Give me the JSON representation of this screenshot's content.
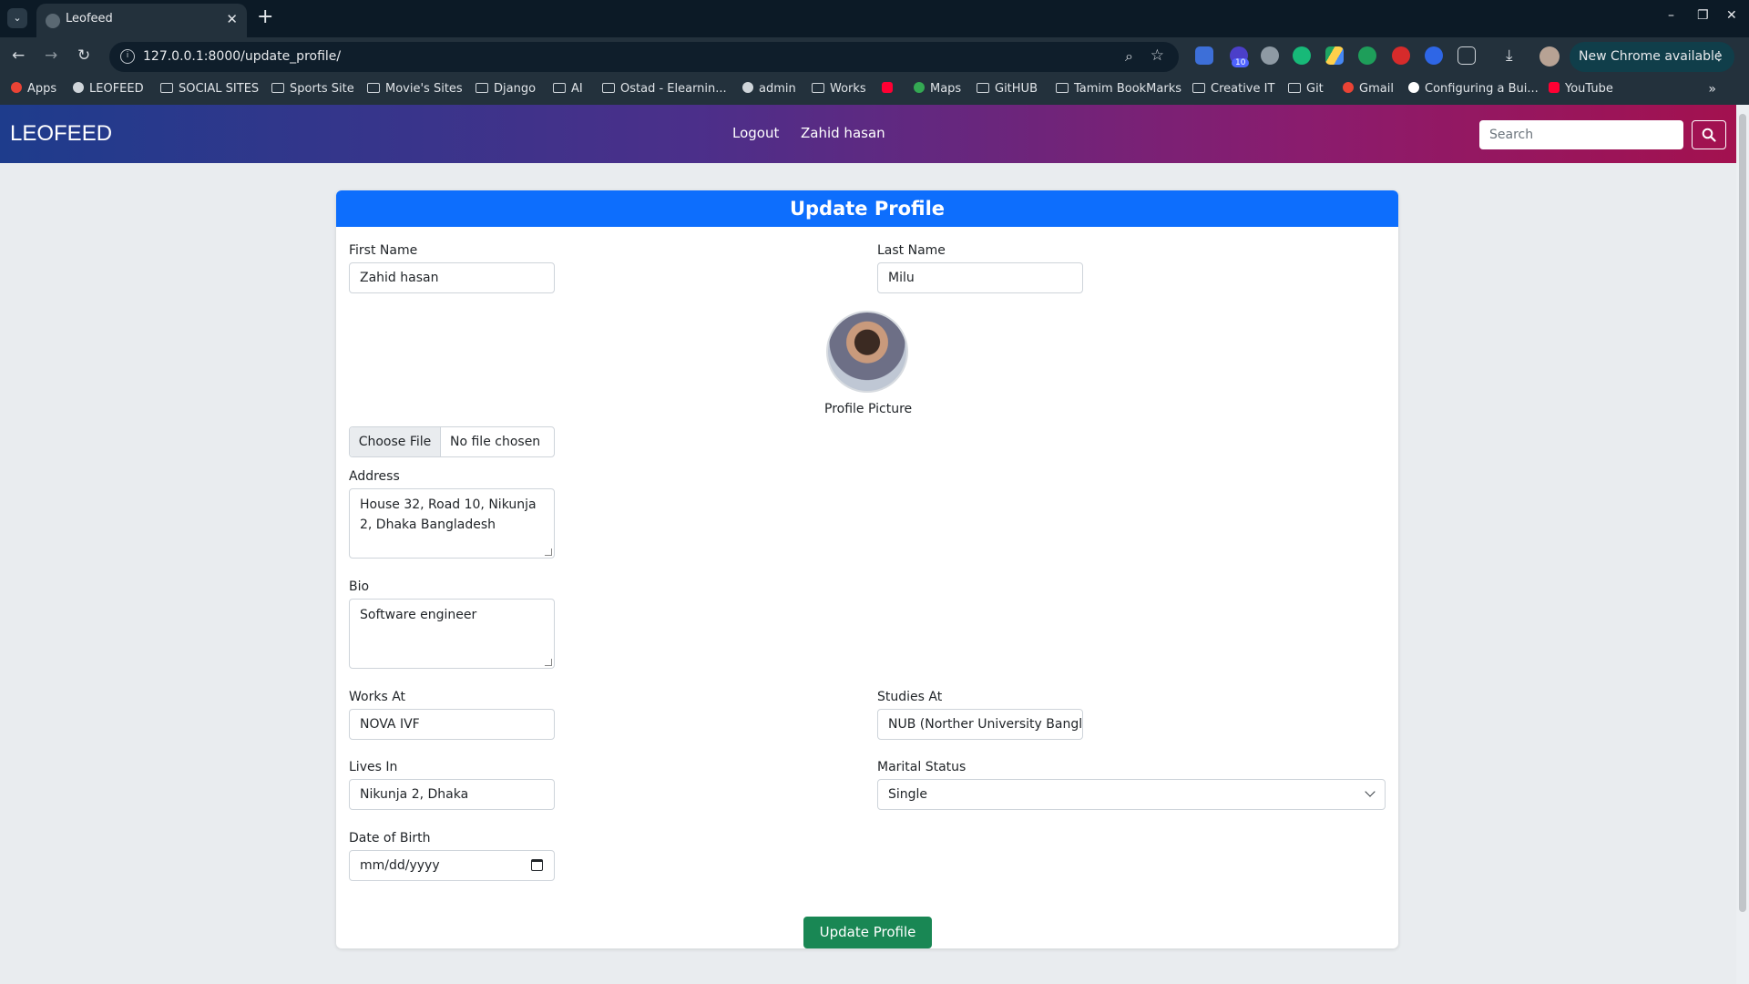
{
  "browser": {
    "tab_title": "Leofeed",
    "url": "127.0.0.1:8000/update_profile/",
    "update_label": "New Chrome available",
    "extension_badge": "10"
  },
  "bookmarks": [
    {
      "label": "Apps",
      "icon": "apps-grid-icon"
    },
    {
      "label": "LEOFEED",
      "icon": "globe-icon"
    },
    {
      "label": "SOCIAL SITES",
      "icon": "folder-icon"
    },
    {
      "label": "Sports Site",
      "icon": "folder-icon"
    },
    {
      "label": "Movie's Sites",
      "icon": "folder-icon"
    },
    {
      "label": "Django",
      "icon": "folder-icon"
    },
    {
      "label": "AI",
      "icon": "folder-icon"
    },
    {
      "label": "Ostad - Elearnin...",
      "icon": "folder-icon"
    },
    {
      "label": "admin",
      "icon": "globe-icon"
    },
    {
      "label": "Works",
      "icon": "folder-icon"
    },
    {
      "label": "",
      "icon": "youtube-icon"
    },
    {
      "label": "Maps",
      "icon": "maps-icon"
    },
    {
      "label": "GitHUB",
      "icon": "folder-icon"
    },
    {
      "label": "Tamim BookMarks",
      "icon": "folder-icon"
    },
    {
      "label": "Creative IT",
      "icon": "folder-icon"
    },
    {
      "label": "Git",
      "icon": "folder-icon"
    },
    {
      "label": "Gmail",
      "icon": "gmail-icon"
    },
    {
      "label": "Configuring a Bui...",
      "icon": "circle-icon"
    },
    {
      "label": "YouTube",
      "icon": "youtube-icon"
    }
  ],
  "nav": {
    "brand": "LEOFEED",
    "logout": "Logout",
    "user_name": "Zahid hasan",
    "search_placeholder": "Search"
  },
  "form": {
    "header": "Update Profile",
    "first_name": {
      "label": "First Name",
      "value": "Zahid hasan"
    },
    "last_name": {
      "label": "Last Name",
      "value": "Milu"
    },
    "profile_picture": {
      "label": "Profile Picture",
      "button": "Choose File",
      "status": "No file chosen"
    },
    "address": {
      "label": "Address",
      "value": "House 32, Road 10, Nikunja 2, Dhaka Bangladesh"
    },
    "bio": {
      "label": "Bio",
      "value": "Software engineer"
    },
    "works_at": {
      "label": "Works At",
      "value": "NOVA IVF"
    },
    "studies_at": {
      "label": "Studies At",
      "value": "NUB (Norther University Bangla"
    },
    "lives_in": {
      "label": "Lives In",
      "value": "Nikunja 2, Dhaka"
    },
    "marital_status": {
      "label": "Marital Status",
      "value": "Single"
    },
    "dob": {
      "label": "Date of Birth",
      "placeholder": "mm/dd/yyyy"
    },
    "submit": "Update Profile"
  }
}
